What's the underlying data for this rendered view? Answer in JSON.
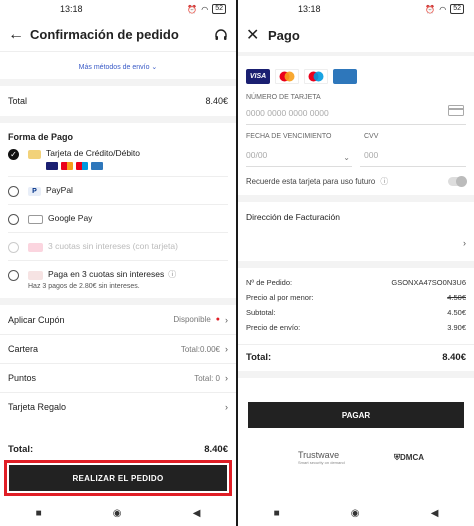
{
  "left": {
    "status_time": "13:18",
    "battery": "52",
    "title": "Confirmación de pedido",
    "shipping_link": "Más métodos de envío ⌄",
    "total_label": "Total",
    "total_value": "8.40€",
    "section_title": "Forma de Pago",
    "methods": {
      "card": "Tarjeta de Crédito/Débito",
      "paypal": "PayPal",
      "gpay": "Google Pay",
      "klarna": "3 cuotas sin intereses (con tarjeta)",
      "three": "Paga en 3 cuotas sin intereses",
      "three_sub": "Haz 3 pagos de 2.80€ sin intereses."
    },
    "options": {
      "coupon_label": "Aplicar Cupón",
      "coupon_value": "Disponible",
      "wallet_label": "Cartera",
      "wallet_value": "Total:0.00€",
      "points_label": "Puntos",
      "points_value": "Total: 0",
      "gift_label": "Tarjeta Regalo"
    },
    "bottom_total_label": "Total:",
    "bottom_total_value": "8.40€",
    "place_order": "REALIZAR EL PEDIDO"
  },
  "right": {
    "status_time": "13:18",
    "battery": "52",
    "title": "Pago",
    "card_number_label": "NÚMERO DE TARJETA",
    "card_number_placeholder": "0000 0000 0000 0000",
    "expiry_label": "FECHA DE VENCIMIENTO",
    "expiry_placeholder": "00/00",
    "cvv_label": "CVV",
    "cvv_placeholder": "000",
    "remember": "Recuerde esta tarjeta para uso futuro",
    "billing": "Dirección de Facturación",
    "summary": {
      "order_label": "Nº de Pedido:",
      "order_value": "GSONXA47SO0N3U6",
      "retail_label": "Precio al por menor:",
      "retail_value": "4.50€",
      "subtotal_label": "Subtotal:",
      "subtotal_value": "4.50€",
      "shipping_label": "Precio de envío:",
      "shipping_value": "3.90€",
      "total_label": "Total:",
      "total_value": "8.40€"
    },
    "pay_button": "PAGAR",
    "trustwave": "Trustwave",
    "trustwave_sub": "Smart security on demand",
    "dmca": "DMCA"
  },
  "colors": {
    "accent_red": "#e01e26",
    "button_dark": "#222222",
    "link_blue": "#3a5bc7"
  }
}
